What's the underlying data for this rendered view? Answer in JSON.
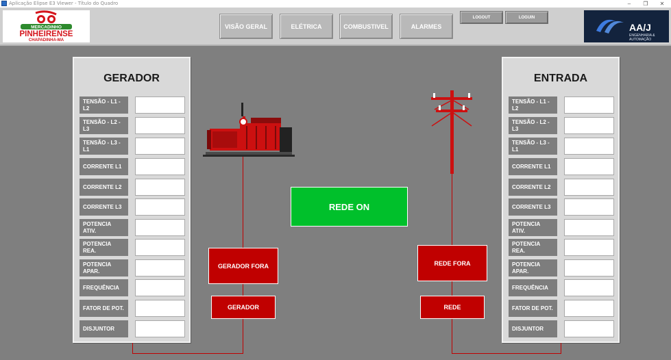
{
  "window": {
    "title": "Aplicação Elipse E3 Viewer - Título do Quadro",
    "controls": [
      "–",
      "❐",
      "✕"
    ]
  },
  "header": {
    "logo_left": {
      "top_text": "MERCADINHO",
      "main_text": "PINHEIRENSE",
      "sub_text": "CHAPADINHA-MA"
    },
    "logo_right": {
      "main_text": "AA/J",
      "sub_text_1": "ENGENHARIA &",
      "sub_text_2": "AUTOMAÇÃO"
    },
    "nav": [
      "VISÃO GERAL",
      "ELÉTRICA",
      "COMBUSTIVEL",
      "ALARMES"
    ],
    "logout_label": "LOGOUT",
    "login_label": "LOGUIN"
  },
  "gerador_panel": {
    "title": "GERADOR",
    "rows": [
      {
        "label": "TENSÃO - L1 - L2",
        "value": ""
      },
      {
        "label": "TENSÃO - L2 - L3",
        "value": ""
      },
      {
        "label": "TENSÃO - L3 - L1",
        "value": ""
      },
      {
        "label": "CORRENTE L1",
        "value": ""
      },
      {
        "label": "CORRENTE L2",
        "value": ""
      },
      {
        "label": "CORRENTE L3",
        "value": ""
      },
      {
        "label": "POTENCIA ATIV.",
        "value": ""
      },
      {
        "label": "POTENCIA REA.",
        "value": ""
      },
      {
        "label": "POTENCIA APAR.",
        "value": ""
      },
      {
        "label": "FREQUÊNCIA",
        "value": ""
      },
      {
        "label": "FATOR DE POT.",
        "value": ""
      },
      {
        "label": "DISJUNTOR",
        "value": ""
      }
    ]
  },
  "entrada_panel": {
    "title": "ENTRADA",
    "rows": [
      {
        "label": "TENSÃO - L1 - L2",
        "value": ""
      },
      {
        "label": "TENSÃO - L2 - L3",
        "value": ""
      },
      {
        "label": "TENSÃO - L3 - L1",
        "value": ""
      },
      {
        "label": "CORRENTE L1",
        "value": ""
      },
      {
        "label": "CORRENTE L2",
        "value": ""
      },
      {
        "label": "CORRENTE L3",
        "value": ""
      },
      {
        "label": "POTENCIA ATIV.",
        "value": ""
      },
      {
        "label": "POTENCIA REA.",
        "value": ""
      },
      {
        "label": "POTENCIA APAR.",
        "value": ""
      },
      {
        "label": "FREQUÊNCIA",
        "value": ""
      },
      {
        "label": "FATOR DE POT.",
        "value": ""
      },
      {
        "label": "DISJUNTOR",
        "value": ""
      }
    ]
  },
  "diagram": {
    "gerador_status": "GERADOR FORA",
    "gerador_button": "GERADOR",
    "rede_status": "REDE FORA",
    "rede_button": "REDE",
    "main_status": "REDE ON"
  },
  "colors": {
    "background": "#7f7f7f",
    "alarm_red": "#c00000",
    "ok_green": "#00c02b",
    "label_gray": "#7d7d7d"
  }
}
